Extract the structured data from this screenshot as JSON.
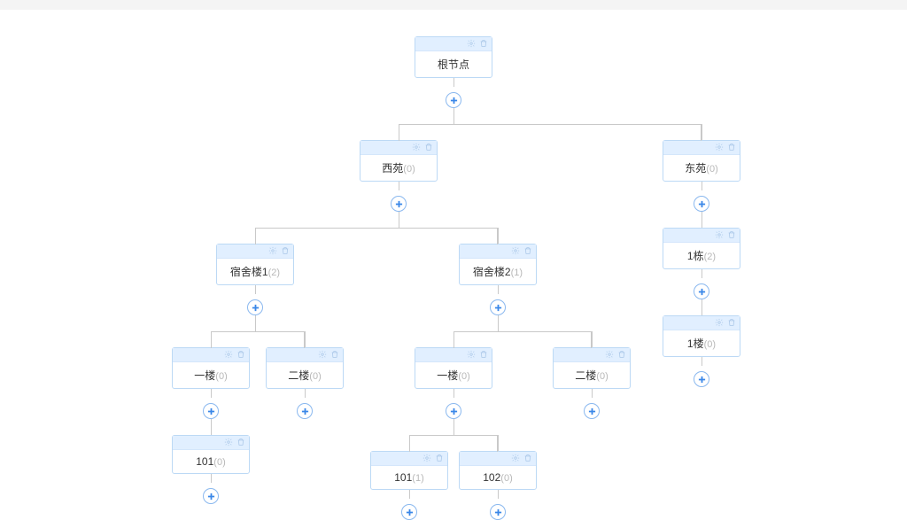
{
  "tree": {
    "root": {
      "label": "根节点",
      "children": [
        {
          "label": "西苑",
          "count": 0,
          "children": [
            {
              "label": "宿舍楼1",
              "count": 2,
              "children": [
                {
                  "label": "一楼",
                  "count": 0,
                  "children": [
                    {
                      "label": "101",
                      "count": 0
                    }
                  ]
                },
                {
                  "label": "二楼",
                  "count": 0
                }
              ]
            },
            {
              "label": "宿舍楼2",
              "count": 1,
              "children": [
                {
                  "label": "一楼",
                  "count": 0,
                  "children": [
                    {
                      "label": "101",
                      "count": 1
                    },
                    {
                      "label": "102",
                      "count": 0
                    }
                  ]
                },
                {
                  "label": "二楼",
                  "count": 0
                }
              ]
            }
          ]
        },
        {
          "label": "东苑",
          "count": 0,
          "children": [
            {
              "label": "1栋",
              "count": 2,
              "children": [
                {
                  "label": "1楼",
                  "count": 0
                }
              ]
            }
          ]
        }
      ]
    }
  }
}
